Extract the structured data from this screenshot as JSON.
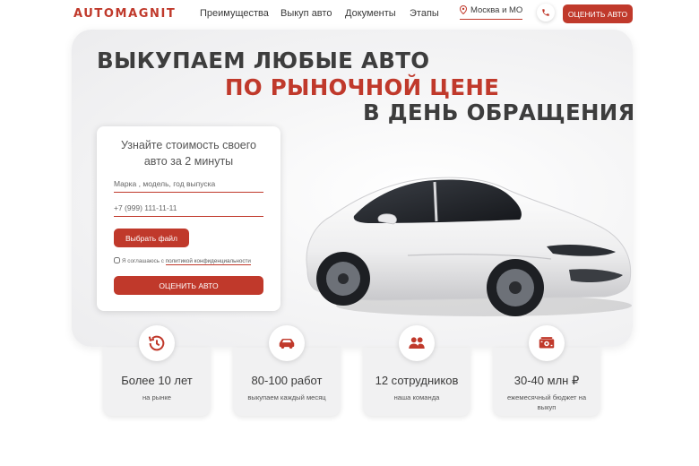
{
  "header": {
    "logo": "AUTOMAGNIT",
    "nav": [
      "Преимущества",
      "Выкуп авто",
      "Документы",
      "Этапы"
    ],
    "city": "Москва и МО",
    "cta": "ОЦЕНИТЬ АВТО"
  },
  "hero": {
    "title_line1": "ВЫКУПАЕМ ЛЮБЫЕ АВТО",
    "title_line2": "ПО РЫНОЧНОЙ ЦЕНЕ",
    "title_line3": "В ДЕНЬ ОБРАЩЕНИЯ"
  },
  "form": {
    "title_line1": "Узнайте стоимость своего",
    "title_line2": "авто за 2 минуты",
    "car_placeholder": "Марка , модель, год выпуска",
    "phone_placeholder": "+7 (999) 111-11-11",
    "file_button": "Выбрать файл",
    "agree_text": "Я соглашаюсь с",
    "policy_link": "политикой конфиденциальности",
    "submit": "ОЦЕНИТЬ АВТО"
  },
  "stats": [
    {
      "icon": "clock-history-icon",
      "value": "Более 10 лет",
      "caption": "на рынке"
    },
    {
      "icon": "car-icon",
      "value": "80-100 работ",
      "caption": "выкупаем каждый месяц"
    },
    {
      "icon": "team-icon",
      "value": "12 сотрудников",
      "caption": "наша команда"
    },
    {
      "icon": "money-icon",
      "value": "30-40 млн ₽",
      "caption": "ежемесячный бюджет на выкуп"
    }
  ],
  "colors": {
    "accent": "#c0392b",
    "text": "#3a3a3a",
    "card": "#f1f1f2"
  }
}
